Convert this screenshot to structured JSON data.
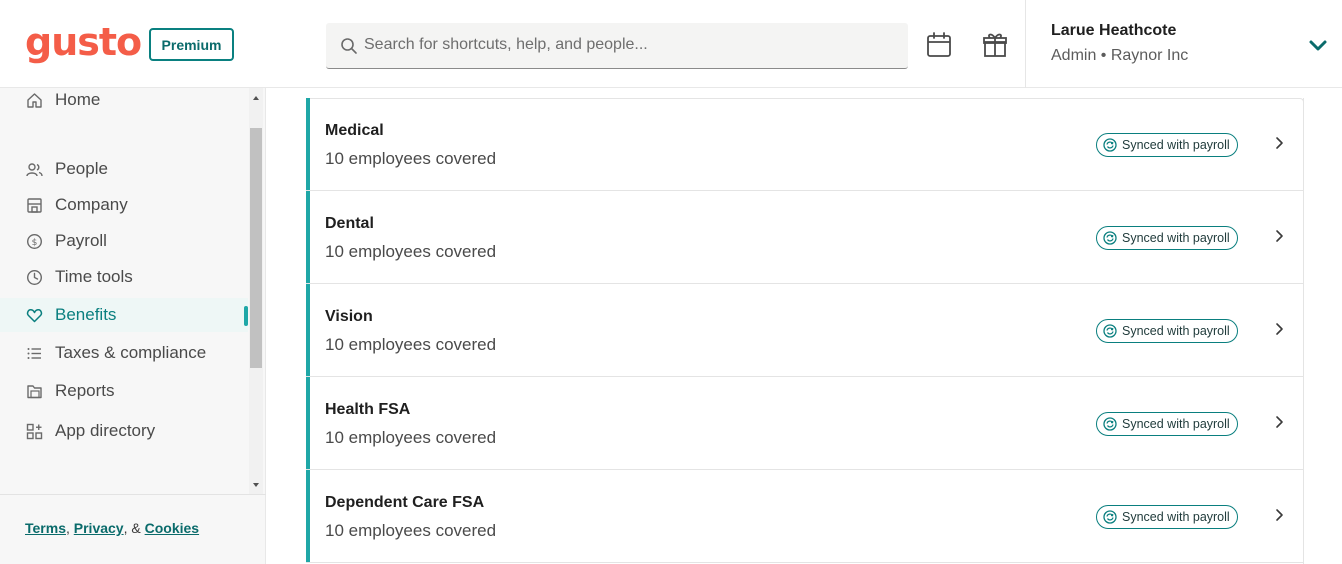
{
  "header": {
    "logo_text": "gusto",
    "plan_badge": "Premium",
    "search_placeholder": "Search for shortcuts, help, and people...",
    "calendar_icon": "calendar-icon",
    "gift_icon": "gift-icon",
    "user_name": "Larue Heathcote",
    "user_role": "Admin • Raynor Inc"
  },
  "sidebar": {
    "items": [
      {
        "label": "Home",
        "icon": "home-icon"
      },
      {
        "label": "People",
        "icon": "people-icon"
      },
      {
        "label": "Company",
        "icon": "company-icon"
      },
      {
        "label": "Payroll",
        "icon": "payroll-icon"
      },
      {
        "label": "Time tools",
        "icon": "clock-icon"
      },
      {
        "label": "Benefits",
        "icon": "heart-icon",
        "active": true
      },
      {
        "label": "Taxes & compliance",
        "icon": "list-icon"
      },
      {
        "label": "Reports",
        "icon": "folder-icon"
      },
      {
        "label": "App directory",
        "icon": "apps-icon"
      }
    ],
    "footer": {
      "terms": "Terms",
      "comma1": ",",
      "privacy": "Privacy",
      "amp": ", &",
      "cookies": "Cookies"
    }
  },
  "benefits": [
    {
      "title": "Medical",
      "subtitle": "10 employees covered",
      "badge": "Synced with payroll"
    },
    {
      "title": "Dental",
      "subtitle": "10 employees covered",
      "badge": "Synced with payroll"
    },
    {
      "title": "Vision",
      "subtitle": "10 employees covered",
      "badge": "Synced with payroll"
    },
    {
      "title": "Health FSA",
      "subtitle": "10 employees covered",
      "badge": "Synced with payroll"
    },
    {
      "title": "Dependent Care FSA",
      "subtitle": "10 employees covered",
      "badge": "Synced with payroll"
    }
  ],
  "colors": {
    "brand": "#f45d48",
    "accent": "#1fa7a7",
    "teal_text": "#0a7f7f"
  }
}
